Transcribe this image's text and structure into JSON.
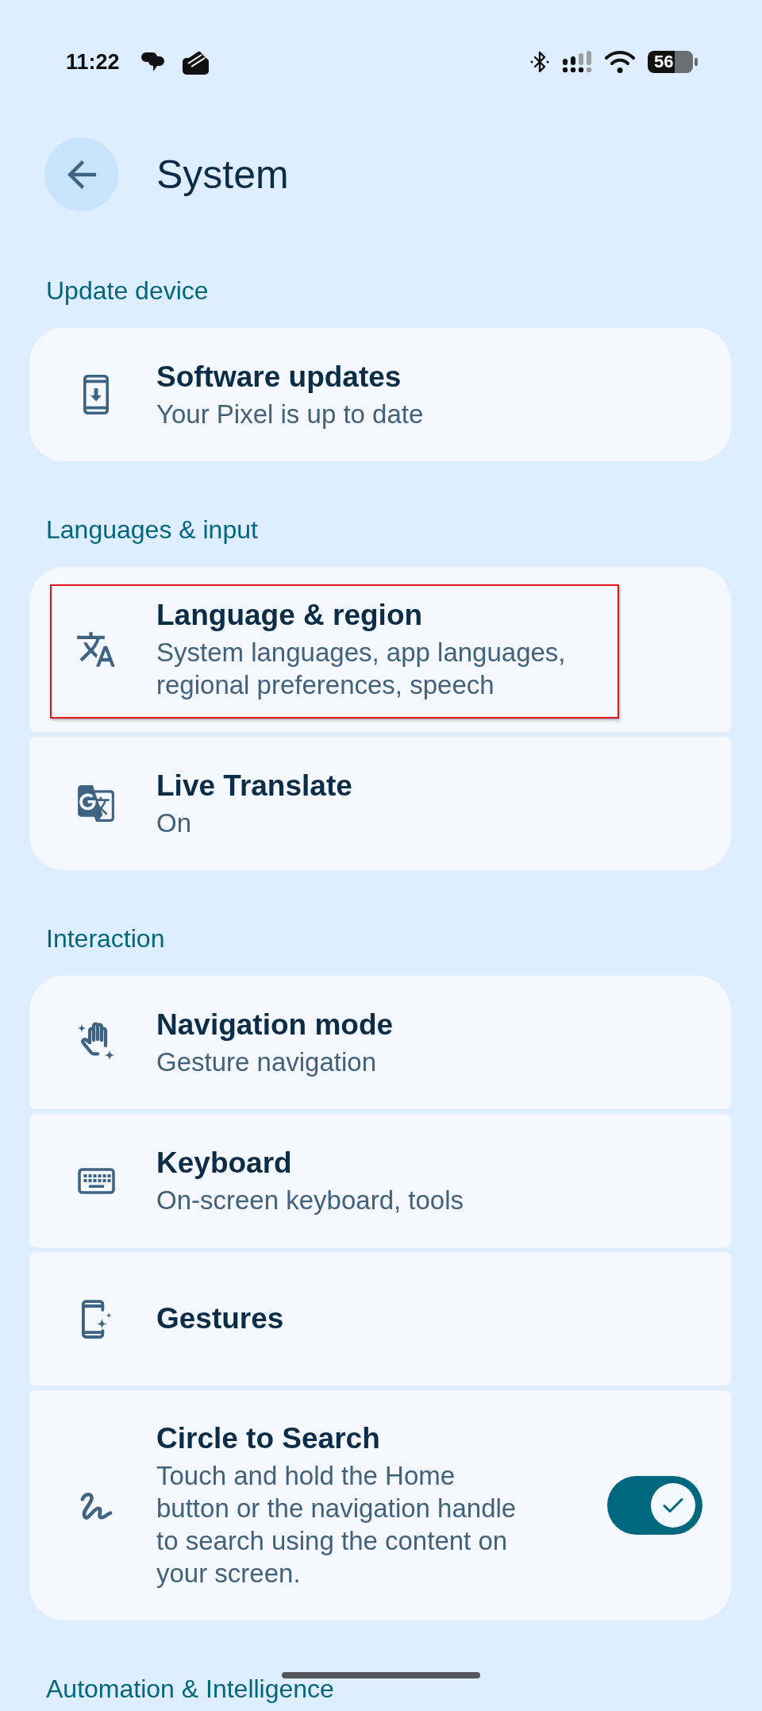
{
  "status_bar": {
    "time": "11:22",
    "battery": "56"
  },
  "header": {
    "title": "System"
  },
  "sections": [
    {
      "title": "Update device",
      "items": [
        {
          "kind": "link",
          "title": "Software updates",
          "subtitle": "Your Pixel is up to date",
          "highlighted": false
        }
      ]
    },
    {
      "title": "Languages & input",
      "items": [
        {
          "kind": "link",
          "title": "Language & region",
          "subtitle": "System languages, app languages, regional preferences, speech",
          "highlighted": true
        },
        {
          "kind": "link",
          "title": "Live Translate",
          "subtitle": "On",
          "highlighted": false
        }
      ]
    },
    {
      "title": "Interaction",
      "items": [
        {
          "kind": "link",
          "title": "Navigation mode",
          "subtitle": "Gesture navigation",
          "highlighted": false
        },
        {
          "kind": "link",
          "title": "Keyboard",
          "subtitle": "On-screen keyboard, tools",
          "highlighted": false
        },
        {
          "kind": "link",
          "title": "Gestures",
          "highlighted": false
        },
        {
          "kind": "toggle",
          "title": "Circle to Search",
          "subtitle": "Touch and hold the Home button or the navigation handle to search using the content on your screen.",
          "on": true,
          "highlighted": false
        }
      ]
    },
    {
      "title": "Automation & Intelligence"
    }
  ]
}
